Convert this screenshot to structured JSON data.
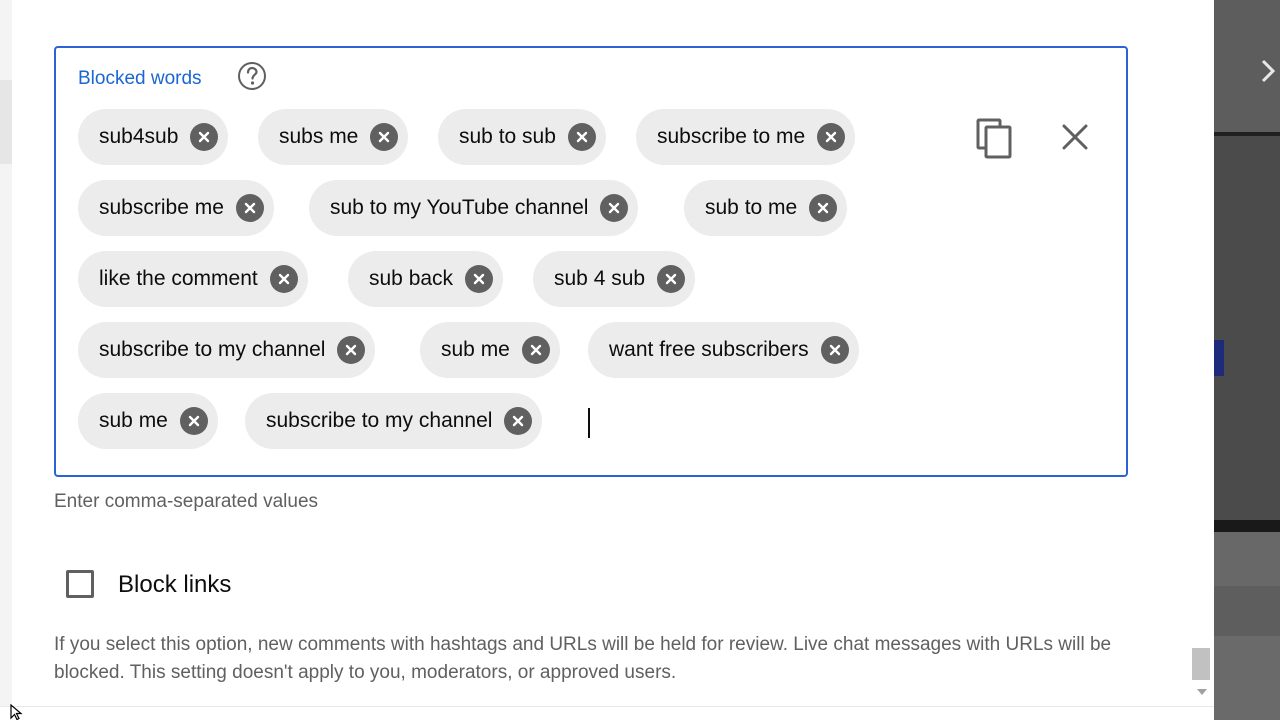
{
  "blocked_words": {
    "label": "Blocked words",
    "hint": "Enter comma-separated values",
    "chips": [
      "sub4sub",
      "subs me",
      "sub to sub",
      "subscribe to me",
      "subscribe me",
      "sub to my YouTube channel",
      "sub to me",
      "like the comment",
      "sub back",
      "sub 4 sub",
      "subscribe to my channel",
      "sub me",
      "want free subscribers",
      "sub me",
      "subscribe to my channel"
    ]
  },
  "block_links": {
    "label": "Block links",
    "checked": false,
    "description": "If you select this option, new comments with hashtags and URLs will be held for review. Live chat messages with URLs will be blocked. This setting doesn't apply to you, moderators, or approved users."
  },
  "icons": {
    "help": "help-circle-icon",
    "copy": "copy-icon",
    "clear": "close-icon",
    "chip_remove": "cancel-circle-icon",
    "next": "chevron-right-icon"
  },
  "colors": {
    "accent": "#1a66d2",
    "field_border": "#2b62d6",
    "chip_bg": "#ececec",
    "chip_x": "#606060"
  }
}
